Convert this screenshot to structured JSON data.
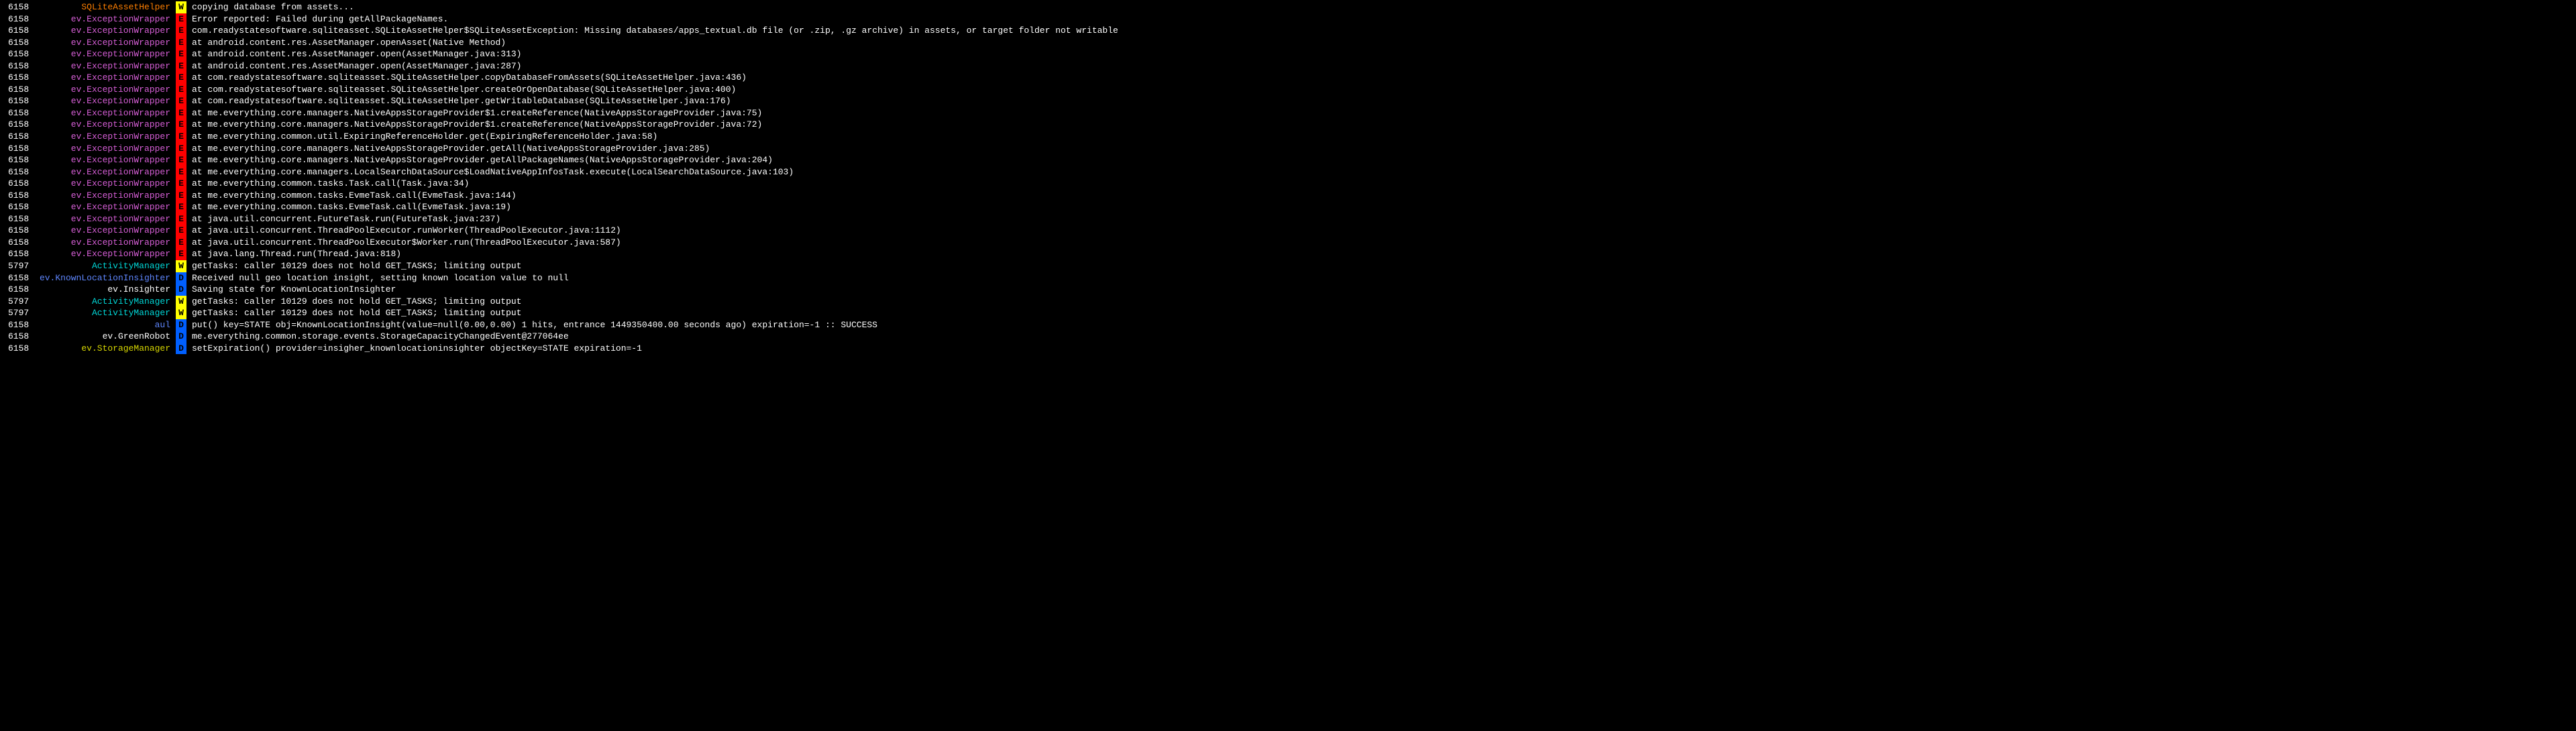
{
  "rows": [
    {
      "pid": "6158",
      "tag": "SQLiteAssetHelper",
      "tagClass": "tag-orange",
      "level": "W",
      "msg": "copying database from assets..."
    },
    {
      "pid": "6158",
      "tag": "ev.ExceptionWrapper",
      "tagClass": "tag-magenta",
      "level": "E",
      "msg": "Error reported: Failed during getAllPackageNames."
    },
    {
      "pid": "6158",
      "tag": "ev.ExceptionWrapper",
      "tagClass": "tag-magenta",
      "level": "E",
      "msg": "com.readystatesoftware.sqliteasset.SQLiteAssetHelper$SQLiteAssetException: Missing databases/apps_textual.db file (or .zip, .gz archive) in assets, or target folder not writable"
    },
    {
      "pid": "6158",
      "tag": "ev.ExceptionWrapper",
      "tagClass": "tag-magenta",
      "level": "E",
      "msg": "at android.content.res.AssetManager.openAsset(Native Method)"
    },
    {
      "pid": "6158",
      "tag": "ev.ExceptionWrapper",
      "tagClass": "tag-magenta",
      "level": "E",
      "msg": "at android.content.res.AssetManager.open(AssetManager.java:313)"
    },
    {
      "pid": "6158",
      "tag": "ev.ExceptionWrapper",
      "tagClass": "tag-magenta",
      "level": "E",
      "msg": "at android.content.res.AssetManager.open(AssetManager.java:287)"
    },
    {
      "pid": "6158",
      "tag": "ev.ExceptionWrapper",
      "tagClass": "tag-magenta",
      "level": "E",
      "msg": "at com.readystatesoftware.sqliteasset.SQLiteAssetHelper.copyDatabaseFromAssets(SQLiteAssetHelper.java:436)"
    },
    {
      "pid": "6158",
      "tag": "ev.ExceptionWrapper",
      "tagClass": "tag-magenta",
      "level": "E",
      "msg": "at com.readystatesoftware.sqliteasset.SQLiteAssetHelper.createOrOpenDatabase(SQLiteAssetHelper.java:400)"
    },
    {
      "pid": "6158",
      "tag": "ev.ExceptionWrapper",
      "tagClass": "tag-magenta",
      "level": "E",
      "msg": "at com.readystatesoftware.sqliteasset.SQLiteAssetHelper.getWritableDatabase(SQLiteAssetHelper.java:176)"
    },
    {
      "pid": "6158",
      "tag": "ev.ExceptionWrapper",
      "tagClass": "tag-magenta",
      "level": "E",
      "msg": "at me.everything.core.managers.NativeAppsStorageProvider$1.createReference(NativeAppsStorageProvider.java:75)"
    },
    {
      "pid": "6158",
      "tag": "ev.ExceptionWrapper",
      "tagClass": "tag-magenta",
      "level": "E",
      "msg": "at me.everything.core.managers.NativeAppsStorageProvider$1.createReference(NativeAppsStorageProvider.java:72)"
    },
    {
      "pid": "6158",
      "tag": "ev.ExceptionWrapper",
      "tagClass": "tag-magenta",
      "level": "E",
      "msg": "at me.everything.common.util.ExpiringReferenceHolder.get(ExpiringReferenceHolder.java:58)"
    },
    {
      "pid": "6158",
      "tag": "ev.ExceptionWrapper",
      "tagClass": "tag-magenta",
      "level": "E",
      "msg": "at me.everything.core.managers.NativeAppsStorageProvider.getAll(NativeAppsStorageProvider.java:285)"
    },
    {
      "pid": "6158",
      "tag": "ev.ExceptionWrapper",
      "tagClass": "tag-magenta",
      "level": "E",
      "msg": "at me.everything.core.managers.NativeAppsStorageProvider.getAllPackageNames(NativeAppsStorageProvider.java:204)"
    },
    {
      "pid": "6158",
      "tag": "ev.ExceptionWrapper",
      "tagClass": "tag-magenta",
      "level": "E",
      "msg": "at me.everything.core.managers.LocalSearchDataSource$LoadNativeAppInfosTask.execute(LocalSearchDataSource.java:103)"
    },
    {
      "pid": "6158",
      "tag": "ev.ExceptionWrapper",
      "tagClass": "tag-magenta",
      "level": "E",
      "msg": "at me.everything.common.tasks.Task.call(Task.java:34)"
    },
    {
      "pid": "6158",
      "tag": "ev.ExceptionWrapper",
      "tagClass": "tag-magenta",
      "level": "E",
      "msg": "at me.everything.common.tasks.EvmeTask.call(EvmeTask.java:144)"
    },
    {
      "pid": "6158",
      "tag": "ev.ExceptionWrapper",
      "tagClass": "tag-magenta",
      "level": "E",
      "msg": "at me.everything.common.tasks.EvmeTask.call(EvmeTask.java:19)"
    },
    {
      "pid": "6158",
      "tag": "ev.ExceptionWrapper",
      "tagClass": "tag-magenta",
      "level": "E",
      "msg": "at java.util.concurrent.FutureTask.run(FutureTask.java:237)"
    },
    {
      "pid": "6158",
      "tag": "ev.ExceptionWrapper",
      "tagClass": "tag-magenta",
      "level": "E",
      "msg": "at java.util.concurrent.ThreadPoolExecutor.runWorker(ThreadPoolExecutor.java:1112)"
    },
    {
      "pid": "6158",
      "tag": "ev.ExceptionWrapper",
      "tagClass": "tag-magenta",
      "level": "E",
      "msg": "at java.util.concurrent.ThreadPoolExecutor$Worker.run(ThreadPoolExecutor.java:587)"
    },
    {
      "pid": "6158",
      "tag": "ev.ExceptionWrapper",
      "tagClass": "tag-magenta",
      "level": "E",
      "msg": "at java.lang.Thread.run(Thread.java:818)"
    },
    {
      "pid": "5797",
      "tag": "ActivityManager",
      "tagClass": "tag-cyan",
      "level": "W",
      "msg": "getTasks: caller 10129 does not hold GET_TASKS; limiting output"
    },
    {
      "pid": "6158",
      "tag": "ev.KnownLocationInsighter",
      "tagClass": "tag-blue",
      "level": "D",
      "msg": "Received null geo location insight, setting known location value to null"
    },
    {
      "pid": "6158",
      "tag": "ev.Insighter",
      "tagClass": "tag-white",
      "level": "D",
      "msg": "Saving state for KnownLocationInsighter"
    },
    {
      "pid": "5797",
      "tag": "ActivityManager",
      "tagClass": "tag-cyan",
      "level": "W",
      "msg": "getTasks: caller 10129 does not hold GET_TASKS; limiting output"
    },
    {
      "pid": "5797",
      "tag": "ActivityManager",
      "tagClass": "tag-cyan",
      "level": "W",
      "msg": "getTasks: caller 10129 does not hold GET_TASKS; limiting output"
    },
    {
      "pid": "6158",
      "tag": "aul",
      "tagClass": "tag-blue",
      "level": "D",
      "msg": "put() key=STATE obj=KnownLocationInsight(value=null(0.00,0.00) 1 hits, entrance 1449350400.00 seconds ago) expiration=-1 :: SUCCESS"
    },
    {
      "pid": "6158",
      "tag": "ev.GreenRobot",
      "tagClass": "tag-white",
      "level": "D",
      "msg": "me.everything.common.storage.events.StorageCapacityChangedEvent@277064ee"
    },
    {
      "pid": "6158",
      "tag": "ev.StorageManager",
      "tagClass": "tag-yellow",
      "level": "D",
      "msg": "setExpiration() provider=insigher_knownlocationinsighter objectKey=STATE expiration=-1"
    }
  ]
}
